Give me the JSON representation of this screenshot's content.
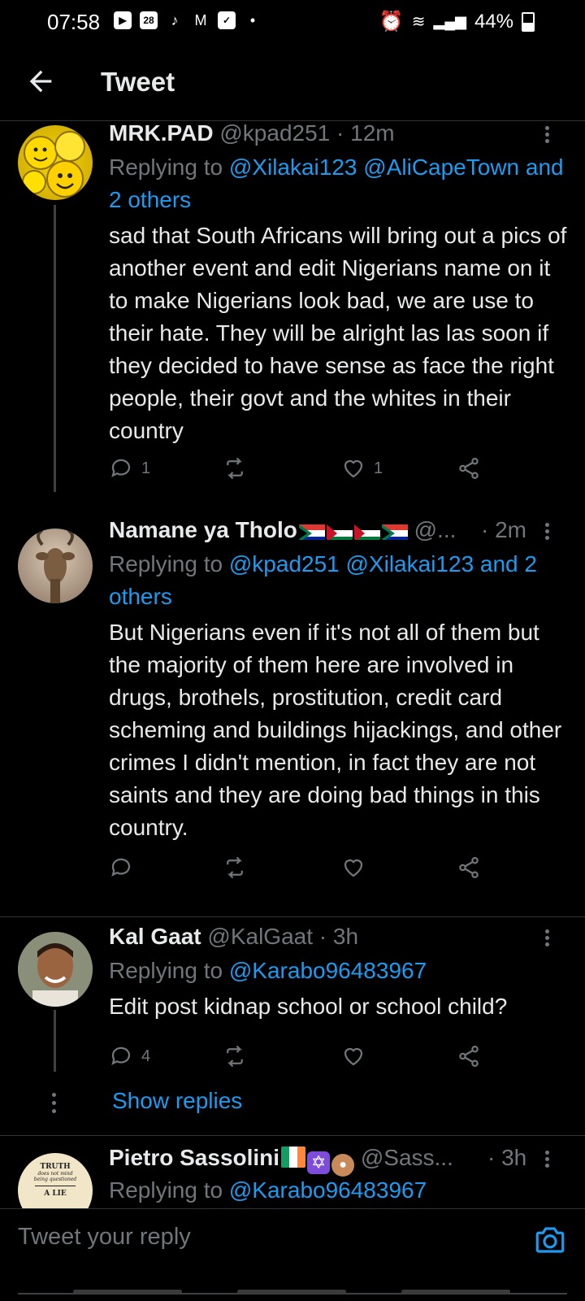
{
  "status_bar": {
    "time": "07:58",
    "calendar_day": "28",
    "battery": "44%",
    "icons": [
      "youtube-icon",
      "calendar-icon",
      "tiktok-icon",
      "gmail-icon",
      "check-icon",
      "dot-icon",
      "alarm-icon",
      "wifi-icon",
      "signal-icon",
      "battery-icon"
    ]
  },
  "header": {
    "title": "Tweet"
  },
  "tweets": [
    {
      "name": "MRK.PAD",
      "handle": "@kpad251",
      "time": "· 12m",
      "replying_prefix": "Replying to",
      "replying_links": "@Xilakai123 @AliCapeTown and 2 others",
      "body": "sad that South Africans will bring out a pics of another event and edit Nigerians name on it to make Nigerians look bad, we are use to their hate. They will be alright las las soon if they decided to have sense as face the right people, their govt and the whites in their country",
      "reply_count": "1",
      "retweet_count": "",
      "like_count": "1"
    },
    {
      "name": "Namane ya Tholo",
      "handle": "@...",
      "time": "· 2m",
      "replying_prefix": "Replying to",
      "replying_links": "@kpad251 @Xilakai123 and 2 others",
      "body": "But Nigerians even if it's not all of them but the majority of them here are involved in drugs, brothels, prostitution, credit card scheming and buildings hijackings, and other crimes I didn't mention, in fact they are not saints and they are doing bad things in this country.",
      "reply_count": "",
      "retweet_count": "",
      "like_count": ""
    },
    {
      "name": "Kal Gaat",
      "handle": "@KalGaat",
      "time": "· 3h",
      "replying_prefix": "Replying to",
      "replying_links": "@Karabo96483967",
      "body": "Edit post kidnap school or school child?",
      "reply_count": "4",
      "retweet_count": "",
      "like_count": "",
      "show_replies": "Show replies"
    },
    {
      "name": "Pietro Sassolini",
      "handle": "@Sass...",
      "time": "· 3h",
      "replying_prefix": "Replying to",
      "replying_links": "@Karabo96483967",
      "avatar_text": [
        "TRUTH",
        "does not mind",
        "being questioned",
        "A LIE"
      ]
    }
  ],
  "reply_box": {
    "placeholder": "Tweet your reply"
  },
  "colors": {
    "background": "#000000",
    "link": "#1d9bf0",
    "muted": "#71767b",
    "text": "#e7e9ea"
  }
}
